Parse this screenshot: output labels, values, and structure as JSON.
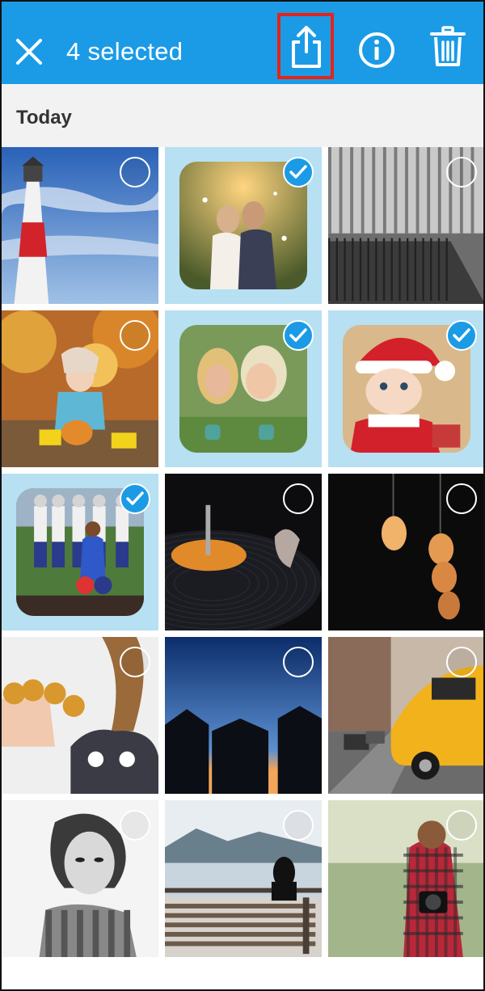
{
  "header": {
    "title": "4 selected",
    "close_icon": "close-icon",
    "share_icon": "share-icon",
    "info_icon": "info-icon",
    "trash_icon": "trash-icon",
    "accent": "#1b9be6",
    "highlight": "#e3241b"
  },
  "section": {
    "label": "Today"
  },
  "photos": [
    {
      "name": "lighthouse",
      "selected": false
    },
    {
      "name": "wedding-kiss",
      "selected": true
    },
    {
      "name": "black-white-walkway",
      "selected": false
    },
    {
      "name": "child-autumn-leaves",
      "selected": false
    },
    {
      "name": "two-women-laughing",
      "selected": true
    },
    {
      "name": "baby-santa-hat",
      "selected": true
    },
    {
      "name": "football-cheerleader",
      "selected": true
    },
    {
      "name": "vinyl-record",
      "selected": false
    },
    {
      "name": "light-bulbs",
      "selected": false
    },
    {
      "name": "girl-donuts-fingers",
      "selected": false
    },
    {
      "name": "houses-silhouette-dusk",
      "selected": false
    },
    {
      "name": "yellow-taxi",
      "selected": false
    },
    {
      "name": "woman-portrait-bw",
      "selected": false
    },
    {
      "name": "bench-by-lake",
      "selected": false
    },
    {
      "name": "photographer-plaid",
      "selected": false
    }
  ]
}
